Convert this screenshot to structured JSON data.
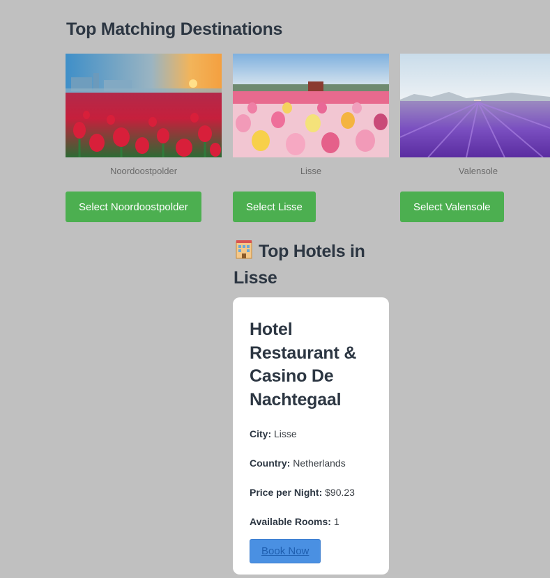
{
  "page": {
    "heading": "Top Matching Destinations"
  },
  "destinations": [
    {
      "name": "Noordoostpolder",
      "button_label": "Select Noordoostpolder"
    },
    {
      "name": "Lisse",
      "button_label": "Select Lisse"
    },
    {
      "name": "Valensole",
      "button_label": "Select Valensole"
    }
  ],
  "hotels": {
    "title": "Top Hotels in Lisse",
    "icon": "hotel-icon",
    "card": {
      "name": "Hotel Restaurant & Casino De Nachtegaal",
      "city_label": "City:",
      "city": "Lisse",
      "country_label": "Country:",
      "country": "Netherlands",
      "price_label": "Price per Night:",
      "price": "$90.23",
      "rooms_label": "Available Rooms:",
      "rooms": "1",
      "book_label": "Book Now"
    }
  },
  "colors": {
    "background": "#c0c0c0",
    "select_button": "#4caf50",
    "book_button": "#4a90e2"
  }
}
